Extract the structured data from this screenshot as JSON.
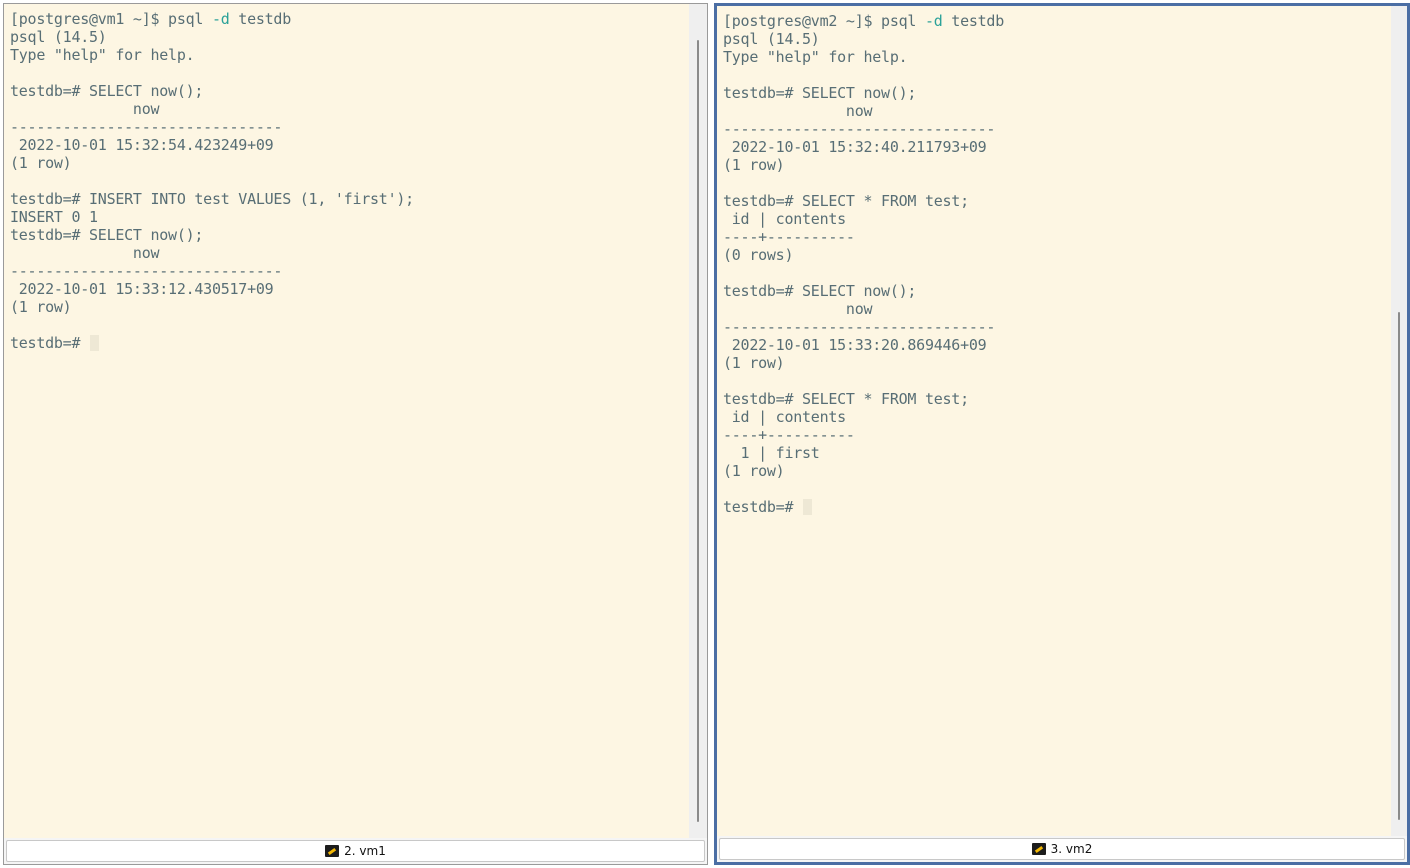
{
  "panes": [
    {
      "prompt_prefix": "[postgres@vm1 ~]$ psql ",
      "prompt_option": "-d",
      "prompt_suffix": " testdb",
      "output": "psql (14.5)\nType \"help\" for help.\n\ntestdb=# SELECT now();\n              now\n-------------------------------\n 2022-10-01 15:32:54.423249+09\n(1 row)\n\ntestdb=# INSERT INTO test VALUES (1, 'first');\nINSERT 0 1\ntestdb=# SELECT now();\n              now\n-------------------------------\n 2022-10-01 15:33:12.430517+09\n(1 row)\n\ntestdb=# ",
      "tab_label": "2. vm1",
      "tab_icon": "wrench-icon"
    },
    {
      "prompt_prefix": "[postgres@vm2 ~]$ psql ",
      "prompt_option": "-d",
      "prompt_suffix": " testdb",
      "output": "psql (14.5)\nType \"help\" for help.\n\ntestdb=# SELECT now();\n              now\n-------------------------------\n 2022-10-01 15:32:40.211793+09\n(1 row)\n\ntestdb=# SELECT * FROM test;\n id | contents\n----+----------\n(0 rows)\n\ntestdb=# SELECT now();\n              now\n-------------------------------\n 2022-10-01 15:33:20.869446+09\n(1 row)\n\ntestdb=# SELECT * FROM test;\n id | contents\n----+----------\n  1 | first\n(1 row)\n\ntestdb=# ",
      "tab_label": "3. vm2",
      "tab_icon": "wrench-icon"
    }
  ],
  "colors": {
    "terminal_bg": "#fdf6e3",
    "terminal_fg": "#586e75",
    "option_fg": "#2aa198",
    "active_border": "#4b6ea4"
  }
}
